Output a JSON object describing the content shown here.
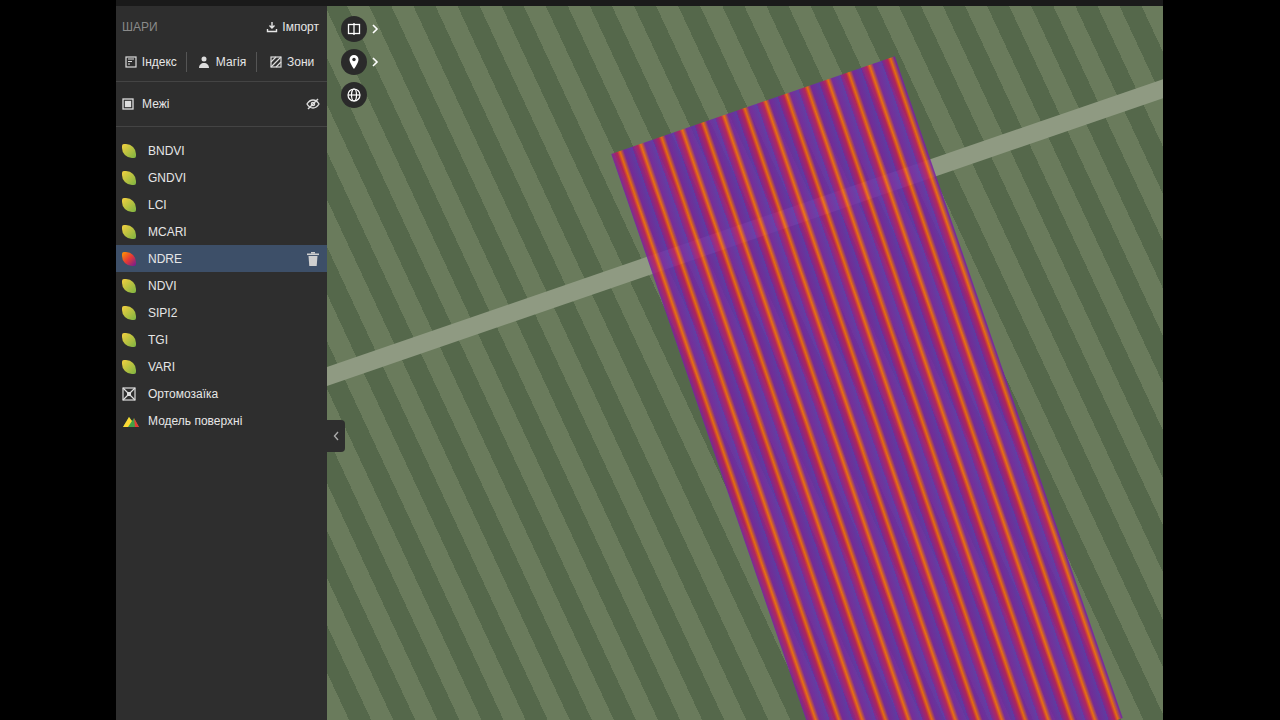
{
  "sidebar": {
    "title": "ШАРИ",
    "import_button": "Імпорт",
    "tools": [
      {
        "label": "Індекс"
      },
      {
        "label": "Магія"
      },
      {
        "label": "Зони"
      }
    ],
    "boundaries": {
      "label": "Межі",
      "visible": false
    },
    "layers": [
      {
        "label": "BNDVI",
        "kind": "index",
        "selected": false
      },
      {
        "label": "GNDVI",
        "kind": "index",
        "selected": false
      },
      {
        "label": "LCI",
        "kind": "index",
        "selected": false
      },
      {
        "label": "MCARI",
        "kind": "index",
        "selected": false
      },
      {
        "label": "NDRE",
        "kind": "palette",
        "selected": true
      },
      {
        "label": "NDVI",
        "kind": "index",
        "selected": false
      },
      {
        "label": "SIPI2",
        "kind": "index",
        "selected": false
      },
      {
        "label": "TGI",
        "kind": "index",
        "selected": false
      },
      {
        "label": "VARI",
        "kind": "index",
        "selected": false
      },
      {
        "label": "Ортомозаїка",
        "kind": "ortho",
        "selected": false
      },
      {
        "label": "Модель поверхні",
        "kind": "surface",
        "selected": false
      }
    ]
  }
}
